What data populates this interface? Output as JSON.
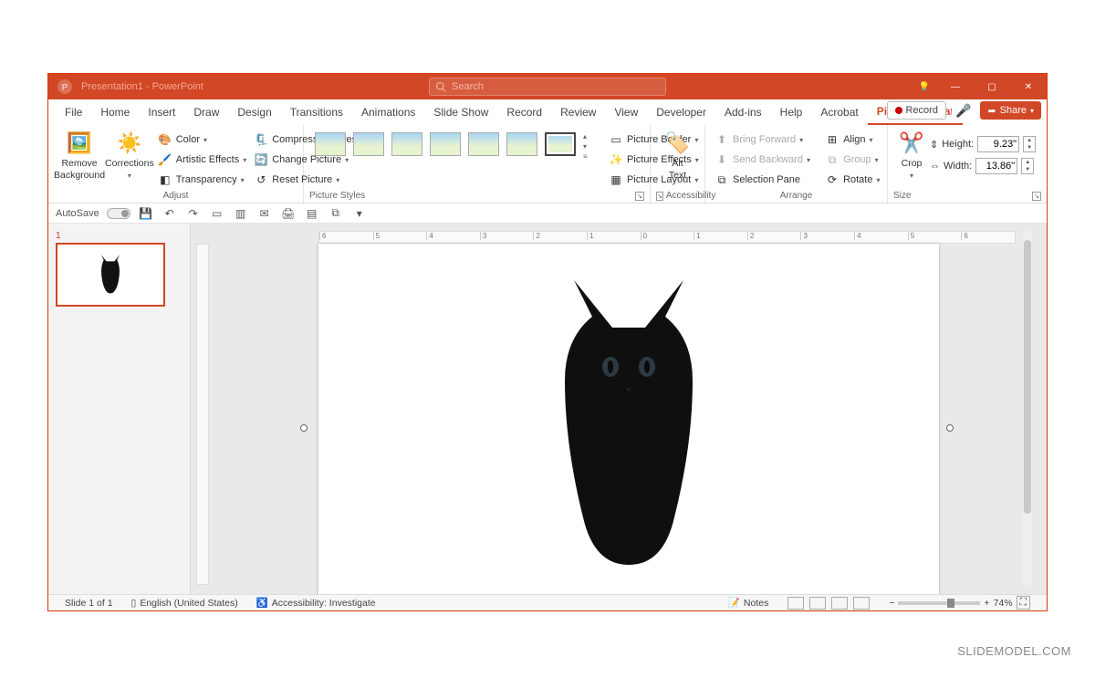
{
  "titlebar": {
    "doc_title": "Presentation1 - PowerPoint",
    "search_placeholder": "Search"
  },
  "window_controls": {
    "min": "—",
    "max": "▢",
    "close": "✕"
  },
  "tabs": [
    "File",
    "Home",
    "Insert",
    "Draw",
    "Design",
    "Transitions",
    "Animations",
    "Slide Show",
    "Record",
    "Review",
    "View",
    "Developer",
    "Add-ins",
    "Help",
    "Acrobat",
    "Picture Format"
  ],
  "tab_active_index": 15,
  "right_actions": {
    "record": "Record",
    "share": "Share"
  },
  "ribbon": {
    "remove_bg": "Remove\nBackground",
    "corrections": "Corrections",
    "color": "Color",
    "artistic": "Artistic Effects",
    "transparency": "Transparency",
    "compress": "Compress Pictures",
    "change_pic": "Change Picture",
    "reset_pic": "Reset Picture",
    "border": "Picture Border",
    "effects": "Picture Effects",
    "layout": "Picture Layout",
    "alt_text": "Alt\nText",
    "bring_fwd": "Bring Forward",
    "send_bwd": "Send Backward",
    "sel_pane": "Selection Pane",
    "align": "Align",
    "group": "Group",
    "rotate": "Rotate",
    "crop": "Crop",
    "height_label": "Height:",
    "width_label": "Width:",
    "height_val": "9.23\"",
    "width_val": "13.86\""
  },
  "group_labels": {
    "adjust": "Adjust",
    "pic_styles": "Picture Styles",
    "accessibility": "Accessibility",
    "arrange": "Arrange",
    "size": "Size"
  },
  "qat": {
    "autosave": "AutoSave"
  },
  "thumbnail": {
    "num": "1"
  },
  "ruler_ticks": [
    "6",
    "5",
    "4",
    "3",
    "2",
    "1",
    "0",
    "1",
    "2",
    "3",
    "4",
    "5",
    "6"
  ],
  "status": {
    "slide": "Slide 1 of 1",
    "lang": "English (United States)",
    "access": "Accessibility: Investigate",
    "notes": "Notes",
    "zoom": "74%"
  },
  "watermark": "SLIDEMODEL.COM"
}
